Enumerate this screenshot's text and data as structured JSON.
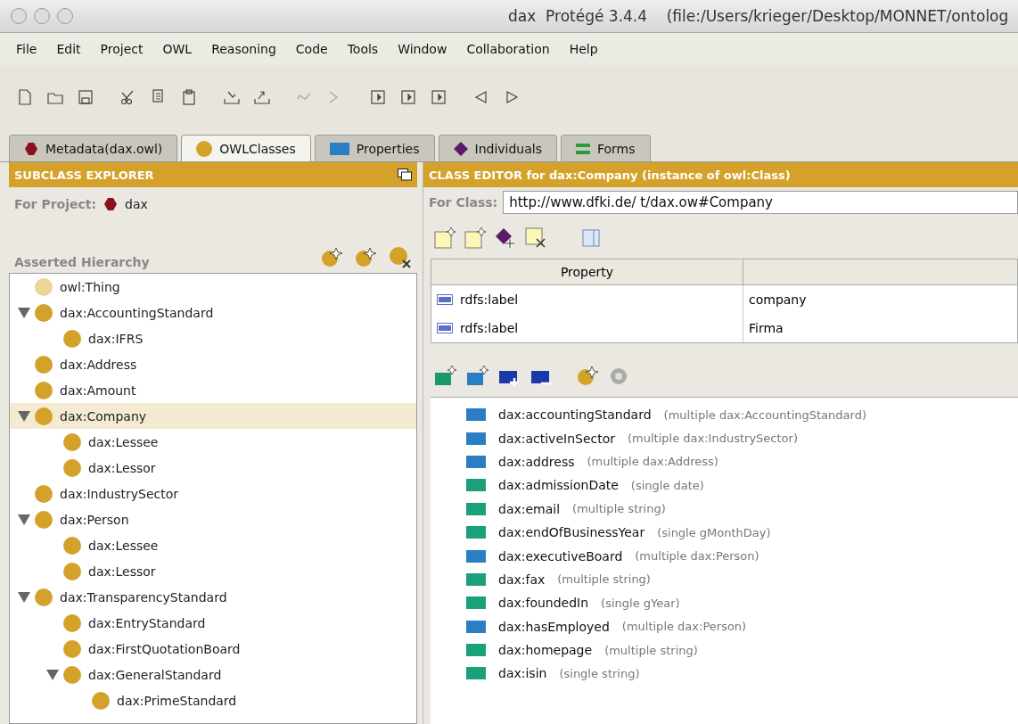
{
  "window": {
    "title": "dax  Protégé 3.4.4    (file:/Users/krieger/Desktop/MONNET/ontolog"
  },
  "menu": [
    "File",
    "Edit",
    "Project",
    "OWL",
    "Reasoning",
    "Code",
    "Tools",
    "Window",
    "Collaboration",
    "Help"
  ],
  "tabs": [
    {
      "label": "Metadata(dax.owl)",
      "kind": "metadata",
      "selected": false
    },
    {
      "label": "OWLClasses",
      "kind": "classes",
      "selected": true
    },
    {
      "label": "Properties",
      "kind": "properties",
      "selected": false
    },
    {
      "label": "Individuals",
      "kind": "individuals",
      "selected": false
    },
    {
      "label": "Forms",
      "kind": "forms",
      "selected": false
    }
  ],
  "subclass_explorer": {
    "title": "SUBCLASS EXPLORER",
    "project_label": "For Project:",
    "project": "dax",
    "hierarchy_label": "Asserted Hierarchy",
    "tree": [
      {
        "label": "owl:Thing",
        "kind": "root",
        "selected": false
      },
      {
        "label": "dax:AccountingStandard",
        "selected": false,
        "expanded": true,
        "children": [
          {
            "label": "dax:IFRS",
            "selected": false
          }
        ]
      },
      {
        "label": "dax:Address",
        "selected": false
      },
      {
        "label": "dax:Amount",
        "selected": false
      },
      {
        "label": "dax:Company",
        "selected": true,
        "expanded": true,
        "children": [
          {
            "label": "dax:Lessee",
            "selected": false
          },
          {
            "label": "dax:Lessor",
            "selected": false
          }
        ]
      },
      {
        "label": "dax:IndustrySector",
        "selected": false
      },
      {
        "label": "dax:Person",
        "selected": false,
        "expanded": true,
        "children": [
          {
            "label": "dax:Lessee",
            "selected": false
          },
          {
            "label": "dax:Lessor",
            "selected": false
          }
        ]
      },
      {
        "label": "dax:TransparencyStandard",
        "selected": false,
        "expanded": true,
        "children": [
          {
            "label": "dax:EntryStandard",
            "selected": false
          },
          {
            "label": "dax:FirstQuotationBoard",
            "selected": false
          },
          {
            "label": "dax:GeneralStandard",
            "selected": false,
            "expanded": true,
            "children": [
              {
                "label": "dax:PrimeStandard",
                "selected": false
              }
            ]
          }
        ]
      }
    ]
  },
  "class_editor": {
    "title": "CLASS EDITOR for dax:Company   (instance of owl:Class)",
    "class_label": "For Class:",
    "class_value": "http://www.dfki.de/ t/dax.ow#Company",
    "table": {
      "columns": [
        "Property"
      ],
      "rows": [
        {
          "property": "rdfs:label",
          "value": "company"
        },
        {
          "property": "rdfs:label",
          "value": "Firma"
        }
      ]
    },
    "properties": [
      {
        "name": "dax:accountingStandard",
        "detail": "(multiple dax:AccountingStandard)",
        "kind": "object"
      },
      {
        "name": "dax:activeInSector",
        "detail": "(multiple dax:IndustrySector)",
        "kind": "object"
      },
      {
        "name": "dax:address",
        "detail": "(multiple dax:Address)",
        "kind": "object"
      },
      {
        "name": "dax:admissionDate",
        "detail": "(single date)",
        "kind": "datatype"
      },
      {
        "name": "dax:email",
        "detail": "(multiple string)",
        "kind": "datatype"
      },
      {
        "name": "dax:endOfBusinessYear",
        "detail": "(single gMonthDay)",
        "kind": "datatype"
      },
      {
        "name": "dax:executiveBoard",
        "detail": "(multiple dax:Person)",
        "kind": "object"
      },
      {
        "name": "dax:fax",
        "detail": "(multiple string)",
        "kind": "datatype"
      },
      {
        "name": "dax:foundedIn",
        "detail": "(single gYear)",
        "kind": "datatype"
      },
      {
        "name": "dax:hasEmployed",
        "detail": "(multiple dax:Person)",
        "kind": "object"
      },
      {
        "name": "dax:homepage",
        "detail": "(multiple string)",
        "kind": "datatype"
      },
      {
        "name": "dax:isin",
        "detail": "(single string)",
        "kind": "datatype"
      }
    ]
  }
}
